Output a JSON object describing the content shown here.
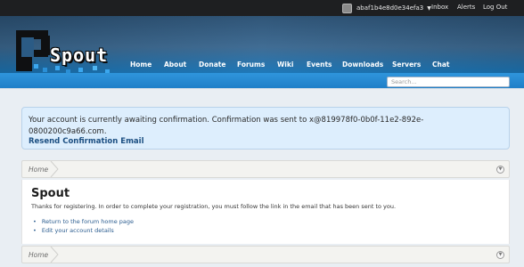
{
  "userbar": {
    "username": "abaf1b4e8d0e34efa3",
    "links": [
      "Inbox",
      "Alerts",
      "Log Out"
    ]
  },
  "logo": {
    "text": "Spout"
  },
  "nav": {
    "items": [
      "Home",
      "About",
      "Donate",
      "Forums",
      "Wiki",
      "Events",
      "Downloads",
      "Servers",
      "Chat"
    ]
  },
  "search": {
    "placeholder": "Search..."
  },
  "notice": {
    "message": "Your account is currently awaiting confirmation. Confirmation was sent to x@819978f0-0b0f-11e2-892e-0800200c9a66.com.",
    "resend": "Resend Confirmation Email"
  },
  "breadcrumb": {
    "home": "Home"
  },
  "content": {
    "title": "Spout",
    "lead": "Thanks for registering. In order to complete your registration, you must follow the link in the email that has been sent to you.",
    "links": [
      "Return to the forum home page",
      "Edit your account details"
    ]
  },
  "colors": {
    "header_top": "#2c5275",
    "subbar": "#2f95dc",
    "notice_bg": "#ddeefd",
    "link": "#2a5c8f"
  }
}
